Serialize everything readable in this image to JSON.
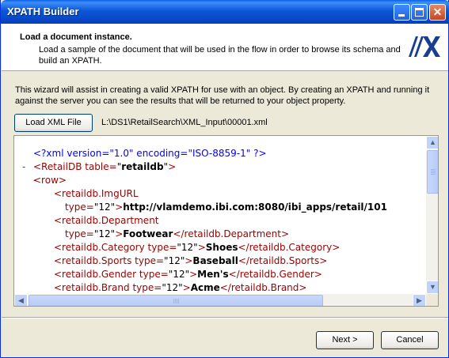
{
  "window": {
    "title": "XPATH Builder"
  },
  "header": {
    "title": "Load a document instance.",
    "description": "Load a sample of the document that will be used in the flow in order to browse its schema and build an XPATH.",
    "logo_text": "//X"
  },
  "intro": "This wizard will assist in creating a valid XPATH for use with an object.   By creating an XPATH and running it against the server you can see the results that will be returned to your object property.",
  "load": {
    "button_label": "Load XML File",
    "file_path": "L:\\DS1\\RetailSearch\\XML_Input\\00001.xml"
  },
  "xml": {
    "lines": [
      {
        "toggle": "",
        "parts": [
          {
            "c": "pi",
            "t": "<?xml version=\"1.0\" encoding=\"ISO-8859-1\" ?>"
          }
        ]
      },
      {
        "toggle": "-",
        "parts": [
          {
            "c": "tag",
            "t": "<RetailDB"
          },
          {
            "c": "an",
            "t": " table="
          },
          {
            "c": "av",
            "t": "\""
          },
          {
            "c": "val",
            "t": "retaildb"
          },
          {
            "c": "av",
            "t": "\""
          },
          {
            "c": "tag",
            "t": ">"
          }
        ]
      },
      {
        "toggle": "-",
        "parts": [
          {
            "c": "tag",
            "t": "<row>"
          }
        ]
      },
      {
        "toggle": "",
        "parts": [
          {
            "c": "tag",
            "t": "<retaildb.ImgURL"
          }
        ]
      },
      {
        "toggle": "",
        "parts": [
          {
            "c": "an",
            "t": "type="
          },
          {
            "c": "av",
            "t": "\"12\""
          },
          {
            "c": "tag",
            "t": ">"
          },
          {
            "c": "val",
            "t": "http://vlamdemo.ibi.com:8080/ibi_apps/retail/101"
          }
        ]
      },
      {
        "toggle": "",
        "parts": [
          {
            "c": "tag",
            "t": "<retaildb.Department"
          }
        ]
      },
      {
        "toggle": "",
        "parts": [
          {
            "c": "an",
            "t": "type="
          },
          {
            "c": "av",
            "t": "\"12\""
          },
          {
            "c": "tag",
            "t": ">"
          },
          {
            "c": "val",
            "t": "Footwear"
          },
          {
            "c": "tag",
            "t": "</retaildb.Department>"
          }
        ]
      },
      {
        "toggle": "",
        "parts": [
          {
            "c": "tag",
            "t": "<retaildb.Category"
          },
          {
            "c": "an",
            "t": " type="
          },
          {
            "c": "av",
            "t": "\"12\""
          },
          {
            "c": "tag",
            "t": ">"
          },
          {
            "c": "val",
            "t": "Shoes"
          },
          {
            "c": "tag",
            "t": "</retaildb.Category>"
          }
        ]
      },
      {
        "toggle": "",
        "parts": [
          {
            "c": "tag",
            "t": "<retaildb.Sports"
          },
          {
            "c": "an",
            "t": " type="
          },
          {
            "c": "av",
            "t": "\"12\""
          },
          {
            "c": "tag",
            "t": ">"
          },
          {
            "c": "val",
            "t": "Baseball"
          },
          {
            "c": "tag",
            "t": "</retaildb.Sports>"
          }
        ]
      },
      {
        "toggle": "",
        "parts": [
          {
            "c": "tag",
            "t": "<retaildb.Gender"
          },
          {
            "c": "an",
            "t": " type="
          },
          {
            "c": "av",
            "t": "\"12\""
          },
          {
            "c": "tag",
            "t": ">"
          },
          {
            "c": "val",
            "t": "Men's"
          },
          {
            "c": "tag",
            "t": "</retaildb.Gender>"
          }
        ]
      },
      {
        "toggle": "",
        "parts": [
          {
            "c": "tag",
            "t": "<retaildb.Brand"
          },
          {
            "c": "an",
            "t": " type="
          },
          {
            "c": "av",
            "t": "\"12\""
          },
          {
            "c": "tag",
            "t": ">"
          },
          {
            "c": "val",
            "t": "Acme"
          },
          {
            "c": "tag",
            "t": "</retaildb.Brand>"
          }
        ]
      }
    ]
  },
  "buttons": {
    "next": "Next >",
    "cancel": "Cancel"
  },
  "colors": {
    "titlebar": "#0a5fe8",
    "tag": "#990000",
    "processing_instruction": "#0000ff",
    "toggle": "#ff0000"
  }
}
